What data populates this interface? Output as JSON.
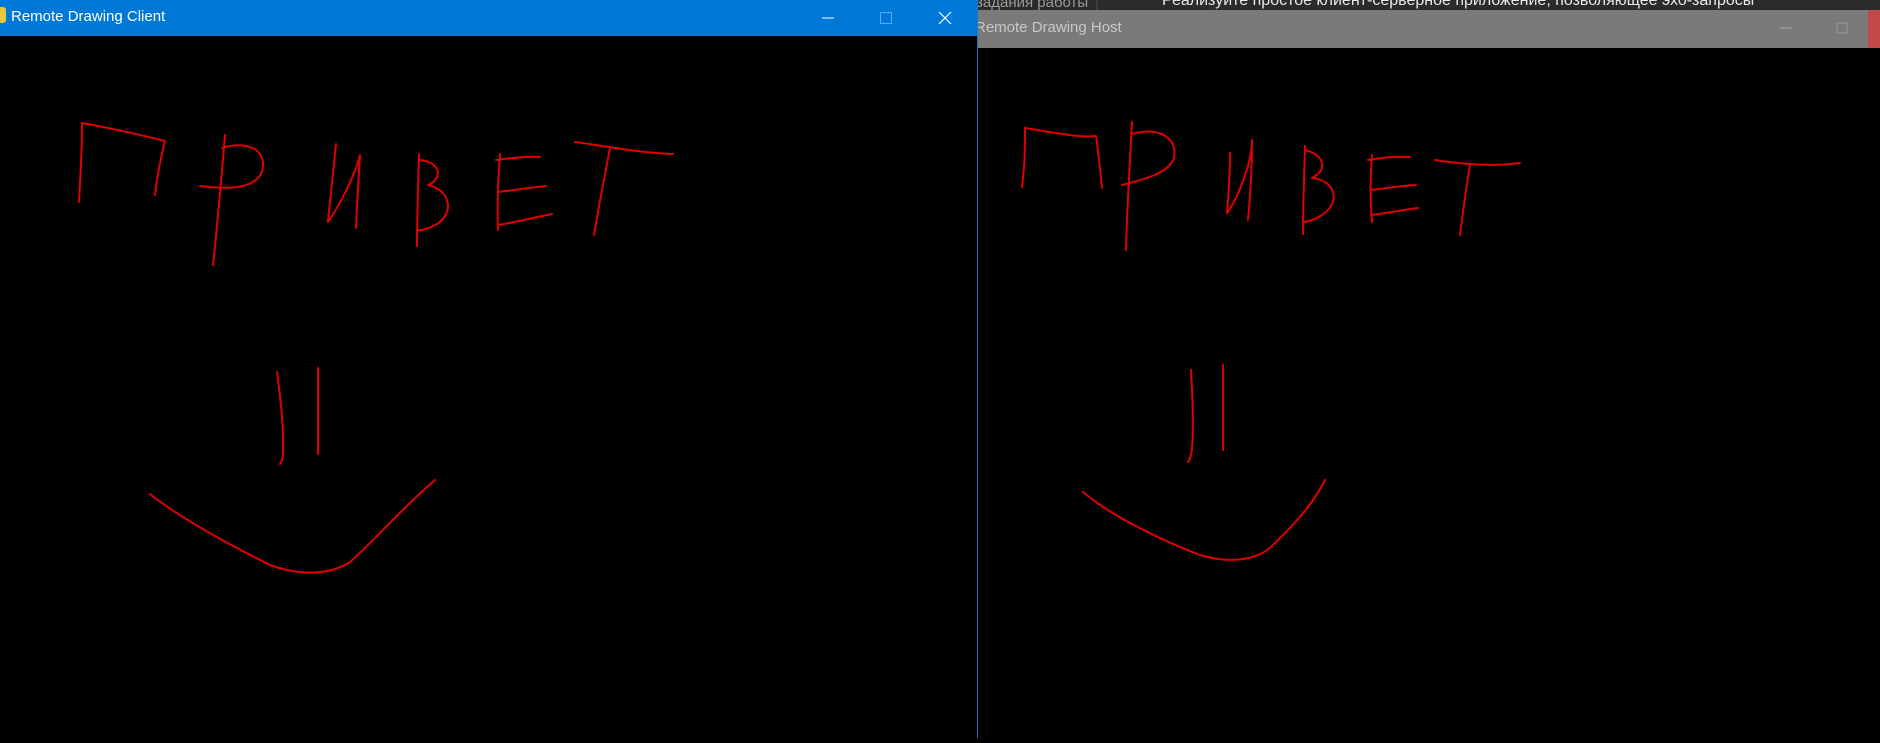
{
  "background": {
    "tab_text": "задания работы",
    "instruction_text": "Реализуйте простое клиент-серверное приложение, позволяющее эхо-запросы"
  },
  "host_window": {
    "title": "Remote Drawing Host",
    "titlebar_color": "#7a7a7a",
    "canvas_color": "#000000",
    "stroke_color": "#e00000",
    "buttons": [
      "minimize-icon",
      "maximize-icon",
      "close-icon"
    ]
  },
  "client_window": {
    "title": "Remote Drawing Client",
    "titlebar_color": "#0078d7",
    "canvas_color": "#000000",
    "stroke_color": "#e00000",
    "buttons": [
      "minimize-icon",
      "maximize-icon",
      "close-icon"
    ]
  }
}
